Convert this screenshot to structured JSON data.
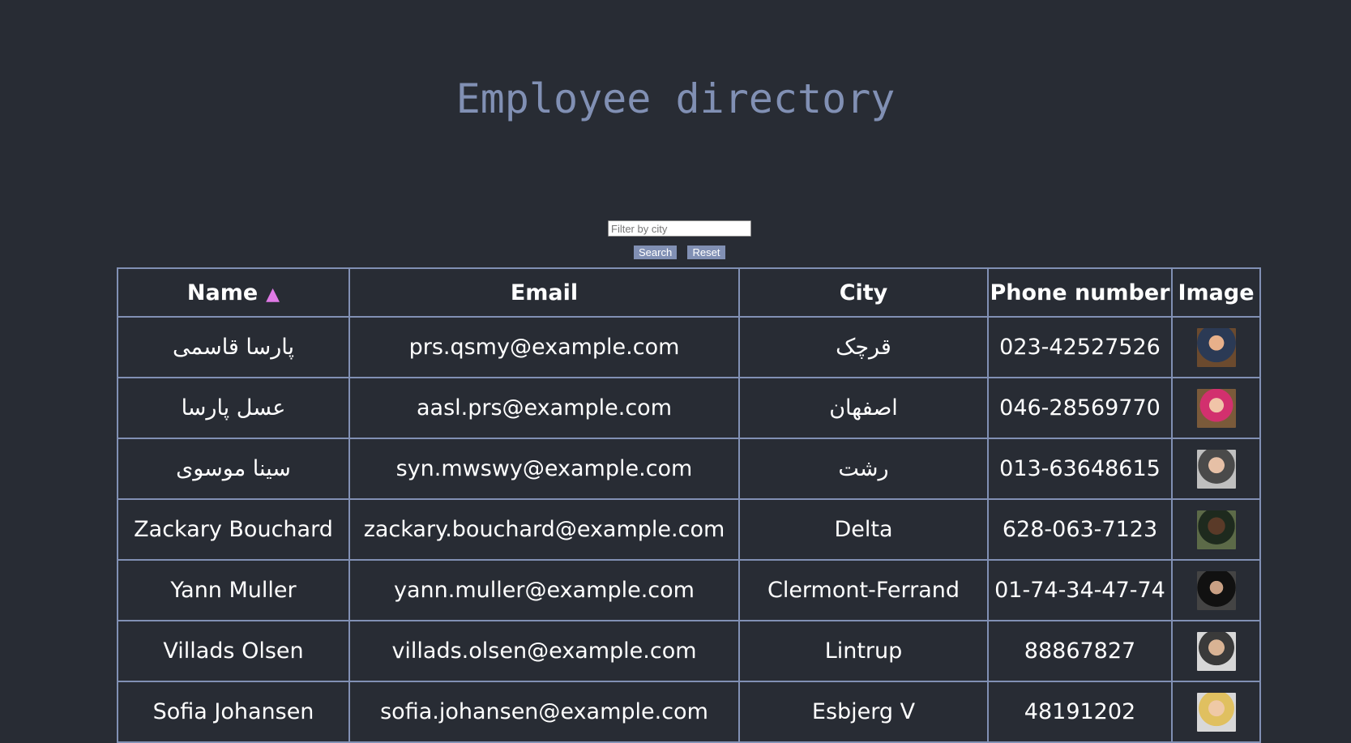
{
  "page": {
    "title": "Employee directory"
  },
  "filter": {
    "placeholder": "Filter by city",
    "value": "",
    "search_label": "Search",
    "reset_label": "Reset"
  },
  "table": {
    "headers": {
      "name": "Name",
      "email": "Email",
      "city": "City",
      "phone": "Phone number",
      "image": "Image"
    },
    "sort": {
      "column": "name",
      "direction": "ascending",
      "indicator": "▲",
      "indicator_color": "#e07ae6"
    },
    "rows": [
      {
        "name": "پارسا قاسمی",
        "email": "prs.qsmy@example.com",
        "city": "قرچک",
        "phone": "023-42527526",
        "image_icon": "avatar-photo"
      },
      {
        "name": "عسل پارسا",
        "email": "aasl.prs@example.com",
        "city": "اصفهان",
        "phone": "046-28569770",
        "image_icon": "avatar-photo"
      },
      {
        "name": "سینا موسوی",
        "email": "syn.mwswy@example.com",
        "city": "رشت",
        "phone": "013-63648615",
        "image_icon": "avatar-photo"
      },
      {
        "name": "Zackary Bouchard",
        "email": "zackary.bouchard@example.com",
        "city": "Delta",
        "phone": "628-063-7123",
        "image_icon": "avatar-photo"
      },
      {
        "name": "Yann Muller",
        "email": "yann.muller@example.com",
        "city": "Clermont-Ferrand",
        "phone": "01-74-34-47-74",
        "image_icon": "avatar-photo"
      },
      {
        "name": "Villads Olsen",
        "email": "villads.olsen@example.com",
        "city": "Lintrup",
        "phone": "88867827",
        "image_icon": "avatar-photo"
      },
      {
        "name": "Sofia Johansen",
        "email": "sofia.johansen@example.com",
        "city": "Esbjerg V",
        "phone": "48191202",
        "image_icon": "avatar-photo"
      }
    ]
  },
  "colors": {
    "background": "#282c34",
    "accent": "#8190b4",
    "text": "#ffffff",
    "sort_indicator": "#e07ae6"
  }
}
